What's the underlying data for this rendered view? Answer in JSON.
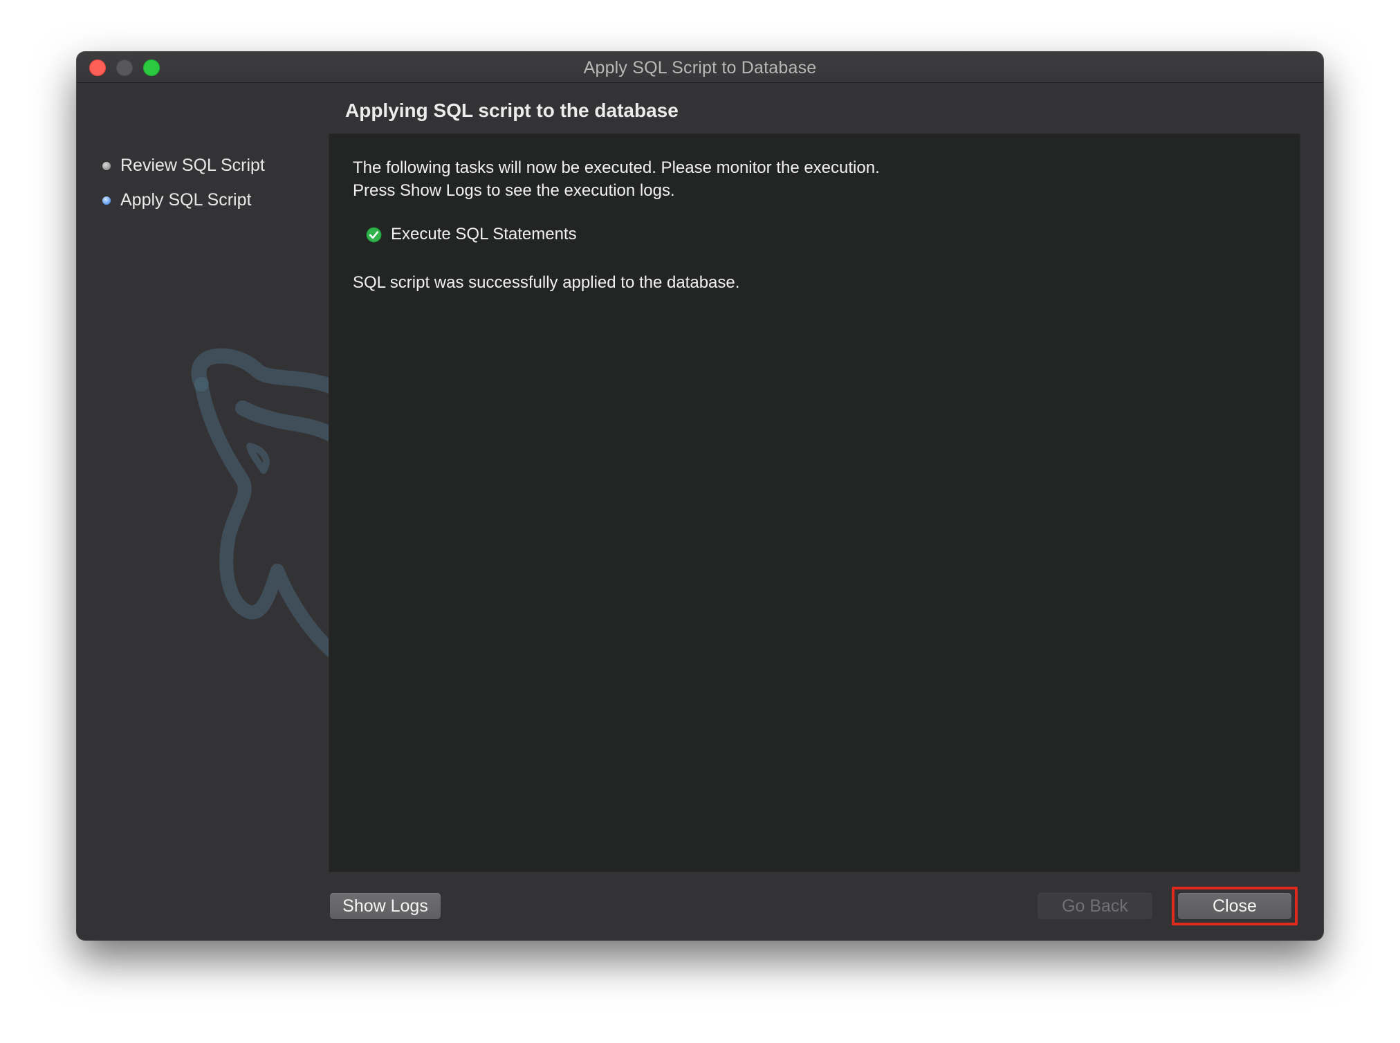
{
  "window": {
    "title": "Apply SQL Script to Database"
  },
  "sidebar": {
    "steps": [
      {
        "label": "Review SQL Script",
        "state": "done"
      },
      {
        "label": "Apply SQL Script",
        "state": "active"
      }
    ]
  },
  "main": {
    "heading": "Applying SQL script to the database",
    "intro_line1": "The following tasks will now be executed. Please monitor the execution.",
    "intro_line2": "Press Show Logs to see the execution logs.",
    "task": {
      "label": "Execute SQL Statements",
      "status": "success",
      "icon": "check-circle-icon"
    },
    "result": "SQL script was successfully applied to the database."
  },
  "buttons": {
    "show_logs": "Show Logs",
    "go_back": "Go Back",
    "close": "Close"
  },
  "colors": {
    "accent_highlight": "#e3281e",
    "success_green": "#2fb34a",
    "active_step_blue": "#2e7ae6"
  }
}
